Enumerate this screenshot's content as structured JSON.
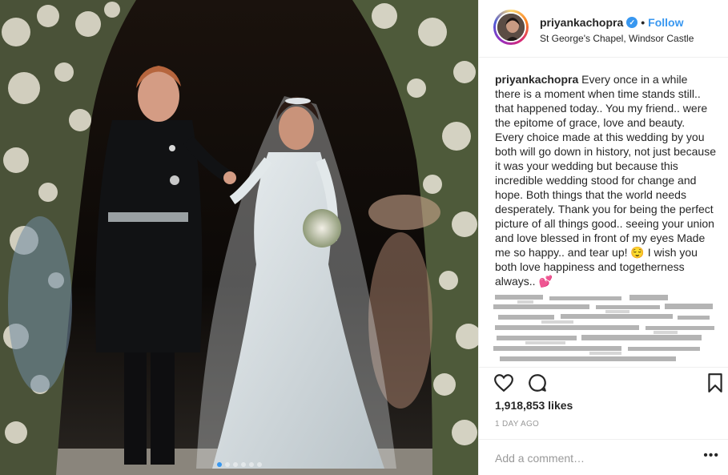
{
  "post": {
    "username": "priyankachopra",
    "verified_icon": "verified-badge-icon",
    "separator": "•",
    "follow_label": "Follow",
    "location": "St George's Chapel, Windsor Castle",
    "caption_user": "priyankachopra",
    "caption_text": "Every once in a while there is a moment when time stands still.. that happened today.. You my friend.. were the epitome of grace, love and beauty. Every choice made at this wedding by you both will go down in history, not just because it was your wedding but because this incredible wedding stood for change and hope. Both things that the world needs desperately. Thank you for being the perfect picture of all things good.. seeing your union and love blessed in front of my eyes Made me so happy.. and tear up! 😌 I wish you both love happiness and togetherness always.. 💕",
    "likes": "1,918,853 likes",
    "time": "1 DAY AGO",
    "comment_placeholder": "Add a comment…",
    "more_label": "•••"
  },
  "carousel": {
    "count": 6,
    "active_index": 0
  },
  "icons": {
    "like": "heart-icon",
    "comment": "comment-icon",
    "save": "bookmark-icon",
    "more": "more-options-icon"
  },
  "colors": {
    "accent": "#3897f0",
    "text": "#262626",
    "muted": "#999999",
    "border": "#efefef"
  }
}
